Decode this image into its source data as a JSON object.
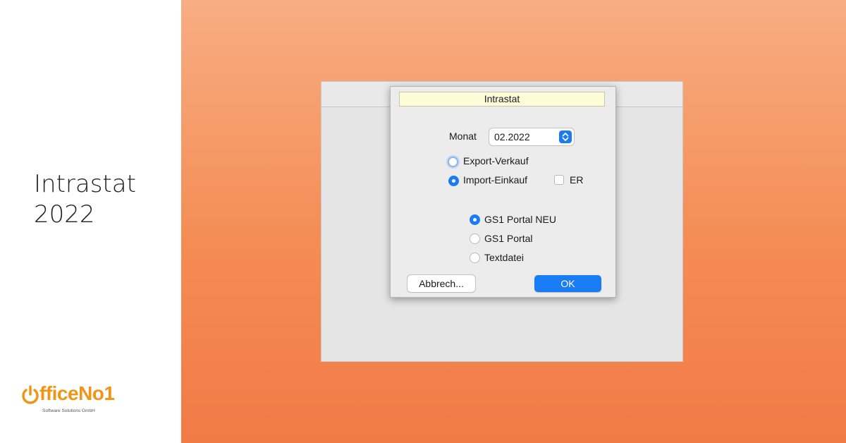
{
  "headline": {
    "line1": "Intrastat",
    "line2": "2022"
  },
  "logo": {
    "name": "OfficeNo1",
    "tagline": "Software Solutions GmbH"
  },
  "dialog": {
    "title": "Intrastat",
    "month_label": "Monat",
    "month_value": "02.2022",
    "direction_options": [
      {
        "label": "Export-Verkauf",
        "selected": false
      },
      {
        "label": "Import-Einkauf",
        "selected": true
      }
    ],
    "er_checkbox": {
      "label": "ER",
      "checked": false
    },
    "format_options": [
      {
        "label": "GS1 Portal NEU",
        "selected": true
      },
      {
        "label": "GS1 Portal",
        "selected": false
      },
      {
        "label": "Textdatei",
        "selected": false
      }
    ],
    "cancel_label": "Abbrech...",
    "ok_label": "OK"
  },
  "colors": {
    "accent": "#1a7cf5",
    "brand": "#f29418",
    "title_bg": "#fdfbd8"
  }
}
